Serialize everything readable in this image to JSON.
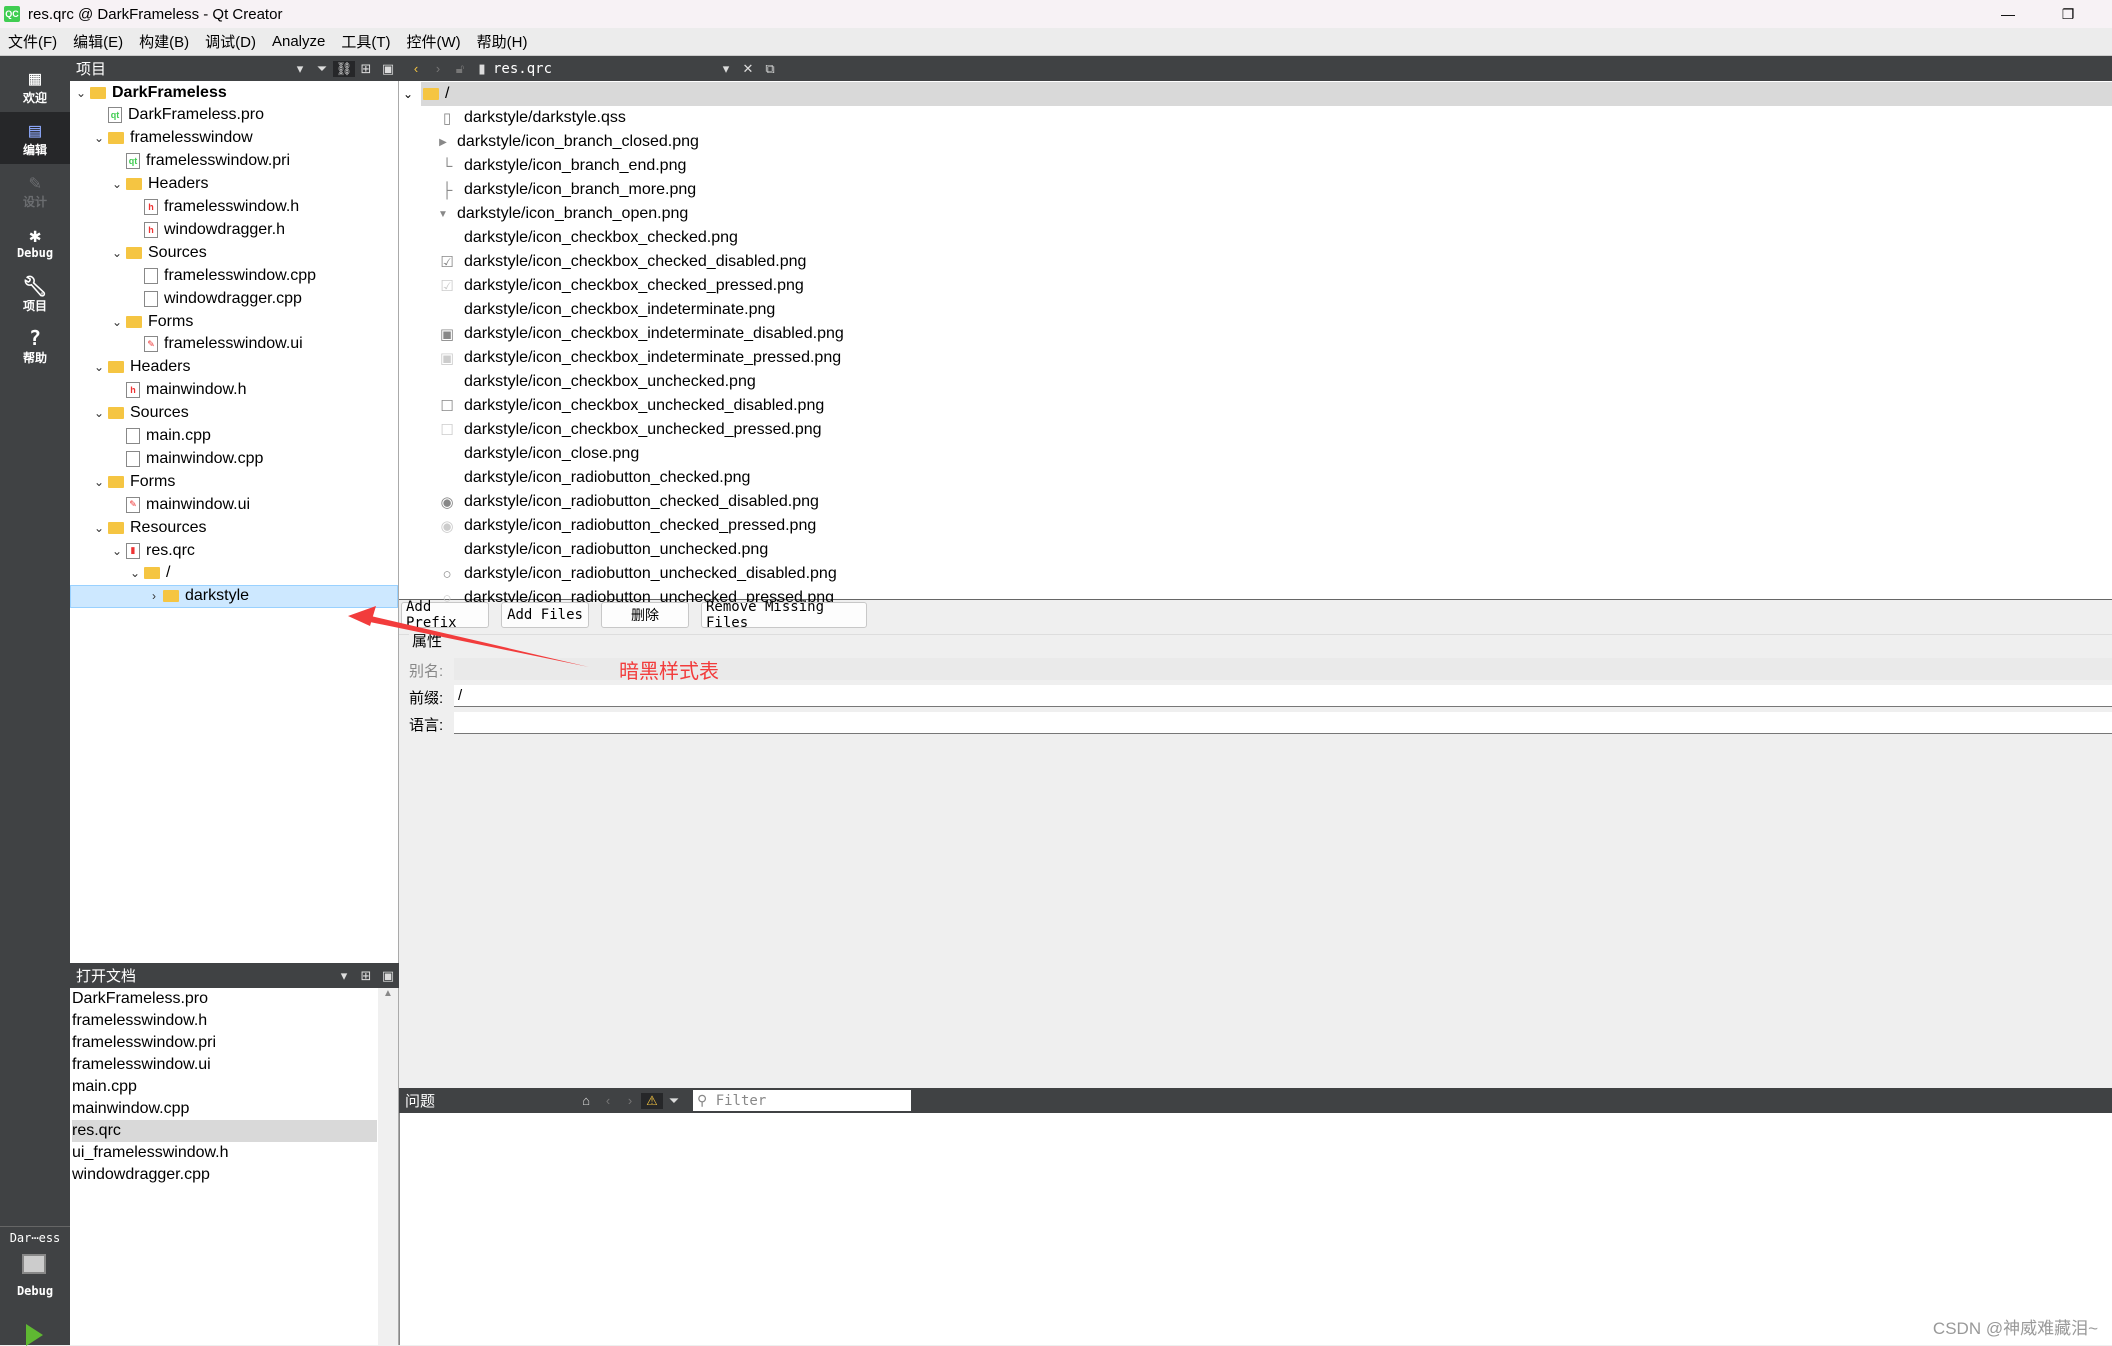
{
  "window": {
    "title": "res.qrc @ DarkFrameless - Qt Creator",
    "logo": "QC",
    "minimize": "—",
    "restore": "❐"
  },
  "menu": [
    "文件(F)",
    "编辑(E)",
    "构建(B)",
    "调试(D)",
    "Analyze",
    "工具(T)",
    "控件(W)",
    "帮助(H)"
  ],
  "modes": [
    {
      "label": "欢迎",
      "icon": "grid-icon"
    },
    {
      "label": "编辑",
      "icon": "edit-icon",
      "active": true
    },
    {
      "label": "设计",
      "icon": "pencil-icon",
      "disabled": true
    },
    {
      "label": "Debug",
      "icon": "bug-icon"
    },
    {
      "label": "项目",
      "icon": "wrench-icon"
    },
    {
      "label": "帮助",
      "icon": "help-icon"
    }
  ],
  "kit": {
    "project": "Dar⋯ess",
    "config": "Debug"
  },
  "project_panel": {
    "title": "项目"
  },
  "project_tree": [
    {
      "label": "DarkFrameless",
      "level": 0,
      "chev": "open",
      "type": "folder",
      "bold": true
    },
    {
      "label": "DarkFrameless.pro",
      "level": 1,
      "type": "pro"
    },
    {
      "label": "framelesswindow",
      "level": 1,
      "chev": "open",
      "type": "folder"
    },
    {
      "label": "framelesswindow.pri",
      "level": 2,
      "type": "pro"
    },
    {
      "label": "Headers",
      "level": 2,
      "chev": "open",
      "type": "folder"
    },
    {
      "label": "framelesswindow.h",
      "level": 3,
      "type": "h"
    },
    {
      "label": "windowdragger.h",
      "level": 3,
      "type": "h"
    },
    {
      "label": "Sources",
      "level": 2,
      "chev": "open",
      "type": "folder"
    },
    {
      "label": "framelesswindow.cpp",
      "level": 3,
      "type": "cpp"
    },
    {
      "label": "windowdragger.cpp",
      "level": 3,
      "type": "cpp"
    },
    {
      "label": "Forms",
      "level": 2,
      "chev": "open",
      "type": "folder"
    },
    {
      "label": "framelesswindow.ui",
      "level": 3,
      "type": "ui"
    },
    {
      "label": "Headers",
      "level": 1,
      "chev": "open",
      "type": "folder"
    },
    {
      "label": "mainwindow.h",
      "level": 2,
      "type": "h"
    },
    {
      "label": "Sources",
      "level": 1,
      "chev": "open",
      "type": "folder"
    },
    {
      "label": "main.cpp",
      "level": 2,
      "type": "cpp"
    },
    {
      "label": "mainwindow.cpp",
      "level": 2,
      "type": "cpp"
    },
    {
      "label": "Forms",
      "level": 1,
      "chev": "open",
      "type": "folder"
    },
    {
      "label": "mainwindow.ui",
      "level": 2,
      "type": "ui"
    },
    {
      "label": "Resources",
      "level": 1,
      "chev": "open",
      "type": "folder"
    },
    {
      "label": "res.qrc",
      "level": 2,
      "chev": "open",
      "type": "qrc"
    },
    {
      "label": "/",
      "level": 3,
      "chev": "open",
      "type": "folder"
    },
    {
      "label": "darkstyle",
      "level": 4,
      "chev": "closed",
      "type": "folder",
      "selected": true
    }
  ],
  "open_docs": {
    "title": "打开文档",
    "items": [
      "DarkFrameless.pro",
      "framelesswindow.h",
      "framelesswindow.pri",
      "framelesswindow.ui",
      "main.cpp",
      "mainwindow.cpp",
      "res.qrc",
      "ui_framelesswindow.h",
      "windowdragger.cpp"
    ],
    "selected": "res.qrc"
  },
  "editor": {
    "file": "res.qrc",
    "root": "/"
  },
  "resources": [
    {
      "label": "darkstyle/darkstyle.qss",
      "icon": "file"
    },
    {
      "label": "darkstyle/icon_branch_closed.png",
      "icon": "tri-right"
    },
    {
      "label": "darkstyle/icon_branch_end.png",
      "icon": "branch-end"
    },
    {
      "label": "darkstyle/icon_branch_more.png",
      "icon": "branch-more"
    },
    {
      "label": "darkstyle/icon_branch_open.png",
      "icon": "tri-down"
    },
    {
      "label": "darkstyle/icon_checkbox_checked.png",
      "icon": ""
    },
    {
      "label": "darkstyle/icon_checkbox_checked_disabled.png",
      "icon": "cb-checked"
    },
    {
      "label": "darkstyle/icon_checkbox_checked_pressed.png",
      "icon": "cb-checked-light"
    },
    {
      "label": "darkstyle/icon_checkbox_indeterminate.png",
      "icon": ""
    },
    {
      "label": "darkstyle/icon_checkbox_indeterminate_disabled.png",
      "icon": "cb-ind"
    },
    {
      "label": "darkstyle/icon_checkbox_indeterminate_pressed.png",
      "icon": "cb-ind-light"
    },
    {
      "label": "darkstyle/icon_checkbox_unchecked.png",
      "icon": ""
    },
    {
      "label": "darkstyle/icon_checkbox_unchecked_disabled.png",
      "icon": "cb-empty"
    },
    {
      "label": "darkstyle/icon_checkbox_unchecked_pressed.png",
      "icon": "cb-empty-light"
    },
    {
      "label": "darkstyle/icon_close.png",
      "icon": ""
    },
    {
      "label": "darkstyle/icon_radiobutton_checked.png",
      "icon": ""
    },
    {
      "label": "darkstyle/icon_radiobutton_checked_disabled.png",
      "icon": "radio-checked"
    },
    {
      "label": "darkstyle/icon_radiobutton_checked_pressed.png",
      "icon": "radio-checked-light"
    },
    {
      "label": "darkstyle/icon_radiobutton_unchecked.png",
      "icon": ""
    },
    {
      "label": "darkstyle/icon_radiobutton_unchecked_disabled.png",
      "icon": "radio-empty"
    },
    {
      "label": "darkstyle/icon_radiobutton_unchecked_pressed.png",
      "icon": "radio-empty-light"
    }
  ],
  "buttons": {
    "add_prefix": "Add Prefix",
    "add_files": "Add Files",
    "delete": "删除",
    "remove_missing": "Remove Missing Files"
  },
  "properties": {
    "title": "属性",
    "alias_label": "别名:",
    "alias_value": "",
    "prefix_label": "前缀:",
    "prefix_value": "/",
    "lang_label": "语言:",
    "lang_value": ""
  },
  "issues": {
    "title": "问题",
    "filter_placeholder": "Filter"
  },
  "annotation": {
    "text": "暗黑样式表",
    "color": "#f23c3c"
  },
  "watermark": "CSDN @神威难藏泪~",
  "colors": {
    "sidebar": "#404244",
    "selection": "#cde8ff",
    "run": "#5fb832"
  }
}
